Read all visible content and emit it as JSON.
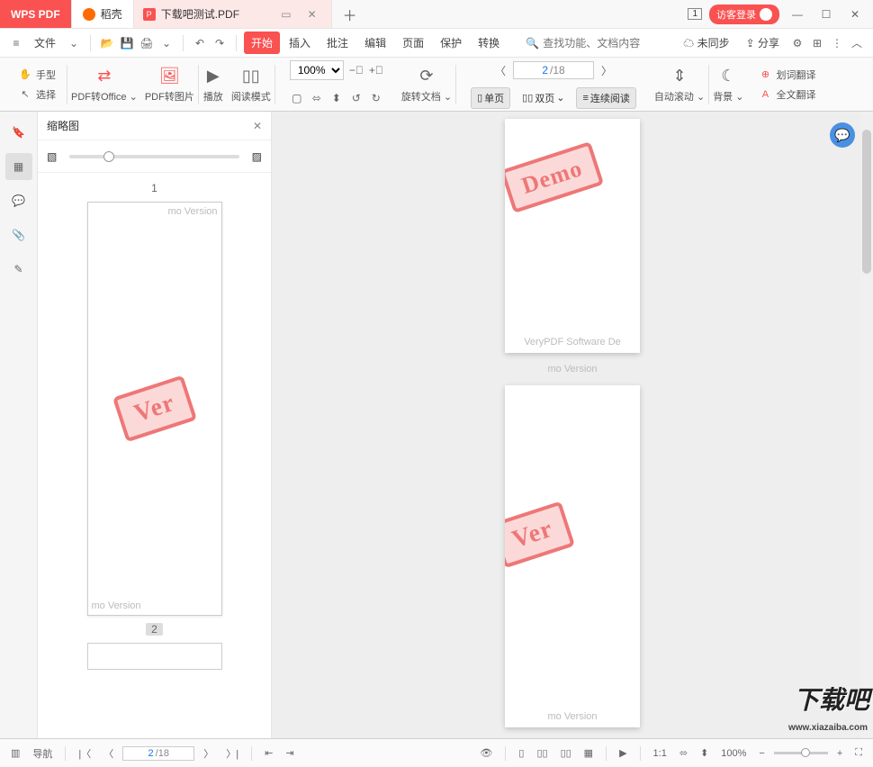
{
  "titlebar": {
    "app_name": "WPS PDF",
    "doke_tab": "稻壳",
    "doc_tab": "下载吧测试.PDF",
    "win_indicator": "1",
    "login": "访客登录"
  },
  "menubar": {
    "file": "文件",
    "tabs": [
      "开始",
      "插入",
      "批注",
      "编辑",
      "页面",
      "保护",
      "转换"
    ],
    "active_tab_index": 0,
    "search_placeholder": "查找功能、文档内容",
    "unsync": "未同步",
    "share": "分享"
  },
  "ribbon": {
    "hand": "手型",
    "select": "选择",
    "pdf_to_office": "PDF转Office",
    "pdf_to_image": "PDF转图片",
    "play": "播放",
    "read_mode": "阅读模式",
    "zoom_value": "100%",
    "rotate_doc": "旋转文档",
    "page_current": "2",
    "page_total": "/18",
    "single_page": "单页",
    "double_page": "双页",
    "continuous": "连续阅读",
    "auto_scroll": "自动滚动",
    "background": "背景",
    "word_trans": "划词翻译",
    "full_trans": "全文翻译"
  },
  "thumbnail": {
    "title": "缩略图",
    "page1_label": "1",
    "page2_label": "2",
    "watermark_partial": "mo Version",
    "stamp_text": "Ver"
  },
  "viewer": {
    "stamp1": "Demo",
    "stamp2": "Ver",
    "footer_text1": "VeryPDF Software De",
    "footer_text2": "mo Version",
    "footer_text3": "mo Version"
  },
  "statusbar": {
    "nav": "导航",
    "page_current": "2",
    "page_total": "/18",
    "zoom": "100%",
    "fit_label": "1:1"
  },
  "overlay": {
    "logo": "下载吧",
    "url": "www.xiazaiba.com"
  }
}
